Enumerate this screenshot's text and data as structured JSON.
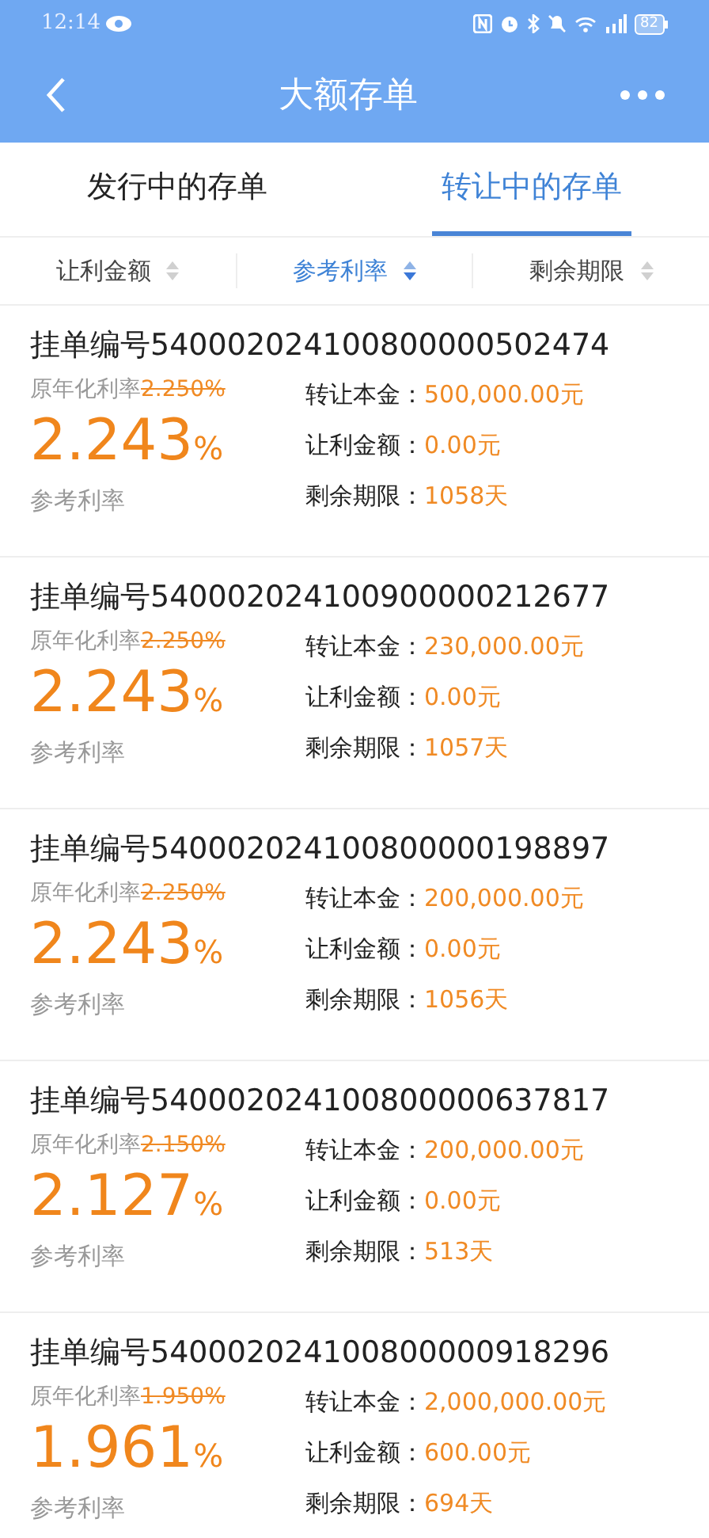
{
  "status_bar": {
    "time": "12:14",
    "battery": "82"
  },
  "header": {
    "title": "大额存单"
  },
  "tabs": [
    {
      "label": "发行中的存单",
      "selected": false
    },
    {
      "label": "转让中的存单",
      "selected": true
    }
  ],
  "sort_options": [
    {
      "label": "让利金额",
      "selected": false
    },
    {
      "label": "参考利率",
      "selected": true
    },
    {
      "label": "剩余期限",
      "selected": false
    }
  ],
  "listings": [
    {
      "title": "挂单编号540002024100800000502474",
      "original_label": "原年化利率",
      "original_rate": "2.250%",
      "rate": "2.243",
      "unit": "%",
      "rate_label": "参考利率",
      "details": [
        {
          "label": "转让本金：",
          "value": "500,000.00元"
        },
        {
          "label": "让利金额：",
          "value": "0.00元"
        },
        {
          "label": "剩余期限：",
          "value": "1058天"
        }
      ]
    },
    {
      "title": "挂单编号540002024100900000212677",
      "original_label": "原年化利率",
      "original_rate": "2.250%",
      "rate": "2.243",
      "unit": "%",
      "rate_label": "参考利率",
      "details": [
        {
          "label": "转让本金：",
          "value": "230,000.00元"
        },
        {
          "label": "让利金额：",
          "value": "0.00元"
        },
        {
          "label": "剩余期限：",
          "value": "1057天"
        }
      ]
    },
    {
      "title": "挂单编号540002024100800000198897",
      "original_label": "原年化利率",
      "original_rate": "2.250%",
      "rate": "2.243",
      "unit": "%",
      "rate_label": "参考利率",
      "details": [
        {
          "label": "转让本金：",
          "value": "200,000.00元"
        },
        {
          "label": "让利金额：",
          "value": "0.00元"
        },
        {
          "label": "剩余期限：",
          "value": "1056天"
        }
      ]
    },
    {
      "title": "挂单编号540002024100800000637817",
      "original_label": "原年化利率",
      "original_rate": "2.150%",
      "rate": "2.127",
      "unit": "%",
      "rate_label": "参考利率",
      "details": [
        {
          "label": "转让本金：",
          "value": "200,000.00元"
        },
        {
          "label": "让利金额：",
          "value": "0.00元"
        },
        {
          "label": "剩余期限：",
          "value": "513天"
        }
      ]
    },
    {
      "title": "挂单编号540002024100800000918296",
      "original_label": "原年化利率",
      "original_rate": "1.950%",
      "rate": "1.961",
      "unit": "%",
      "rate_label": "参考利率",
      "details": [
        {
          "label": "转让本金：",
          "value": "2,000,000.00元"
        },
        {
          "label": "让利金额：",
          "value": "600.00元"
        },
        {
          "label": "剩余期限：",
          "value": "694天"
        }
      ]
    }
  ]
}
